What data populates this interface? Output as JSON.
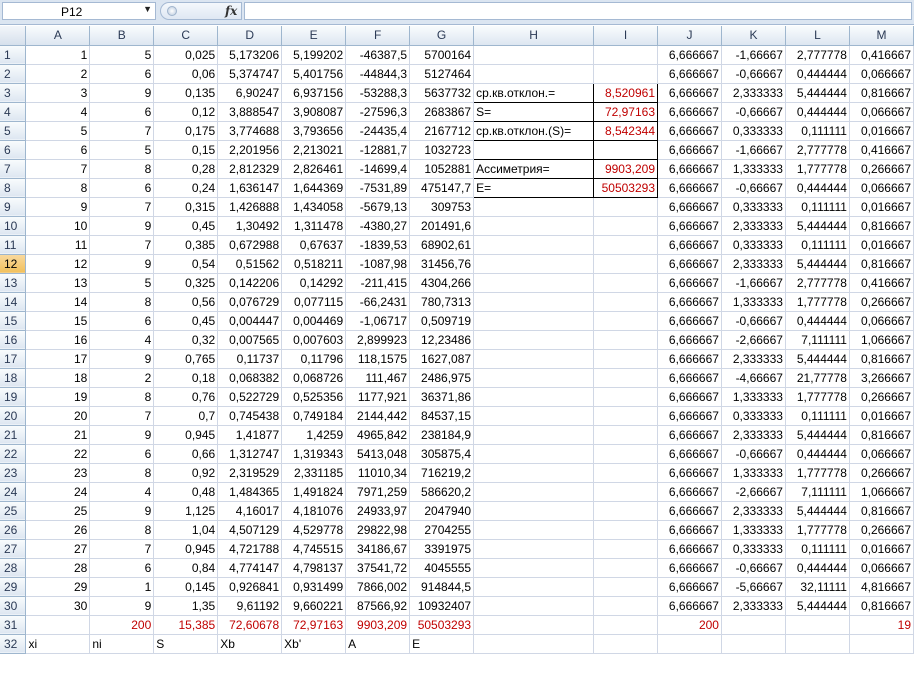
{
  "name_box": "P12",
  "fx_label": "fx",
  "columns": [
    "",
    "A",
    "B",
    "C",
    "D",
    "E",
    "F",
    "G",
    "H",
    "I",
    "J",
    "K",
    "L",
    "M"
  ],
  "selected_row": "12",
  "rows": [
    [
      "1",
      "1",
      "5",
      "0,025",
      "5,173206",
      "5,199202",
      "-46387,5",
      "5700164",
      "",
      "",
      "6,666667",
      "-1,66667",
      "2,777778",
      "0,416667"
    ],
    [
      "2",
      "2",
      "6",
      "0,06",
      "5,374747",
      "5,401756",
      "-44844,3",
      "5127464",
      "",
      "",
      "6,666667",
      "-0,66667",
      "0,444444",
      "0,066667"
    ],
    [
      "3",
      "3",
      "9",
      "0,135",
      "6,90247",
      "6,937156",
      "-53288,3",
      "5637732",
      "ср.кв.отклон.=",
      "8,520961",
      "6,666667",
      "2,333333",
      "5,444444",
      "0,816667"
    ],
    [
      "4",
      "4",
      "6",
      "0,12",
      "3,888547",
      "3,908087",
      "-27596,3",
      "2683867",
      "S=",
      "72,97163",
      "6,666667",
      "-0,66667",
      "0,444444",
      "0,066667"
    ],
    [
      "5",
      "5",
      "7",
      "0,175",
      "3,774688",
      "3,793656",
      "-24435,4",
      "2167712",
      "ср.кв.отклон.(S)=",
      "8,542344",
      "6,666667",
      "0,333333",
      "0,111111",
      "0,016667"
    ],
    [
      "6",
      "6",
      "5",
      "0,15",
      "2,201956",
      "2,213021",
      "-12881,7",
      "1032723",
      "",
      "",
      "6,666667",
      "-1,66667",
      "2,777778",
      "0,416667"
    ],
    [
      "7",
      "7",
      "8",
      "0,28",
      "2,812329",
      "2,826461",
      "-14699,4",
      "1052881",
      "Ассиметрия=",
      "9903,209",
      "6,666667",
      "1,333333",
      "1,777778",
      "0,266667"
    ],
    [
      "8",
      "8",
      "6",
      "0,24",
      "1,636147",
      "1,644369",
      "-7531,89",
      "475147,7",
      "E=",
      "50503293",
      "6,666667",
      "-0,66667",
      "0,444444",
      "0,066667"
    ],
    [
      "9",
      "9",
      "7",
      "0,315",
      "1,426888",
      "1,434058",
      "-5679,13",
      "309753",
      "",
      "",
      "6,666667",
      "0,333333",
      "0,111111",
      "0,016667"
    ],
    [
      "10",
      "10",
      "9",
      "0,45",
      "1,30492",
      "1,311478",
      "-4380,27",
      "201491,6",
      "",
      "",
      "6,666667",
      "2,333333",
      "5,444444",
      "0,816667"
    ],
    [
      "11",
      "11",
      "7",
      "0,385",
      "0,672988",
      "0,67637",
      "-1839,53",
      "68902,61",
      "",
      "",
      "6,666667",
      "0,333333",
      "0,111111",
      "0,016667"
    ],
    [
      "12",
      "12",
      "9",
      "0,54",
      "0,51562",
      "0,518211",
      "-1087,98",
      "31456,76",
      "",
      "",
      "6,666667",
      "2,333333",
      "5,444444",
      "0,816667"
    ],
    [
      "13",
      "13",
      "5",
      "0,325",
      "0,142206",
      "0,14292",
      "-211,415",
      "4304,266",
      "",
      "",
      "6,666667",
      "-1,66667",
      "2,777778",
      "0,416667"
    ],
    [
      "14",
      "14",
      "8",
      "0,56",
      "0,076729",
      "0,077115",
      "-66,2431",
      "780,7313",
      "",
      "",
      "6,666667",
      "1,333333",
      "1,777778",
      "0,266667"
    ],
    [
      "15",
      "15",
      "6",
      "0,45",
      "0,004447",
      "0,004469",
      "-1,06717",
      "0,509719",
      "",
      "",
      "6,666667",
      "-0,66667",
      "0,444444",
      "0,066667"
    ],
    [
      "16",
      "16",
      "4",
      "0,32",
      "0,007565",
      "0,007603",
      "2,899923",
      "12,23486",
      "",
      "",
      "6,666667",
      "-2,66667",
      "7,111111",
      "1,066667"
    ],
    [
      "17",
      "17",
      "9",
      "0,765",
      "0,11737",
      "0,11796",
      "118,1575",
      "1627,087",
      "",
      "",
      "6,666667",
      "2,333333",
      "5,444444",
      "0,816667"
    ],
    [
      "18",
      "18",
      "2",
      "0,18",
      "0,068382",
      "0,068726",
      "111,467",
      "2486,975",
      "",
      "",
      "6,666667",
      "-4,66667",
      "21,77778",
      "3,266667"
    ],
    [
      "19",
      "19",
      "8",
      "0,76",
      "0,522729",
      "0,525356",
      "1177,921",
      "36371,86",
      "",
      "",
      "6,666667",
      "1,333333",
      "1,777778",
      "0,266667"
    ],
    [
      "20",
      "20",
      "7",
      "0,7",
      "0,745438",
      "0,749184",
      "2144,442",
      "84537,15",
      "",
      "",
      "6,666667",
      "0,333333",
      "0,111111",
      "0,016667"
    ],
    [
      "21",
      "21",
      "9",
      "0,945",
      "1,41877",
      "1,4259",
      "4965,842",
      "238184,9",
      "",
      "",
      "6,666667",
      "2,333333",
      "5,444444",
      "0,816667"
    ],
    [
      "22",
      "22",
      "6",
      "0,66",
      "1,312747",
      "1,319343",
      "5413,048",
      "305875,4",
      "",
      "",
      "6,666667",
      "-0,66667",
      "0,444444",
      "0,066667"
    ],
    [
      "23",
      "23",
      "8",
      "0,92",
      "2,319529",
      "2,331185",
      "11010,34",
      "716219,2",
      "",
      "",
      "6,666667",
      "1,333333",
      "1,777778",
      "0,266667"
    ],
    [
      "24",
      "24",
      "4",
      "0,48",
      "1,484365",
      "1,491824",
      "7971,259",
      "586620,2",
      "",
      "",
      "6,666667",
      "-2,66667",
      "7,111111",
      "1,066667"
    ],
    [
      "25",
      "25",
      "9",
      "1,125",
      "4,16017",
      "4,181076",
      "24933,97",
      "2047940",
      "",
      "",
      "6,666667",
      "2,333333",
      "5,444444",
      "0,816667"
    ],
    [
      "26",
      "26",
      "8",
      "1,04",
      "4,507129",
      "4,529778",
      "29822,98",
      "2704255",
      "",
      "",
      "6,666667",
      "1,333333",
      "1,777778",
      "0,266667"
    ],
    [
      "27",
      "27",
      "7",
      "0,945",
      "4,721788",
      "4,745515",
      "34186,67",
      "3391975",
      "",
      "",
      "6,666667",
      "0,333333",
      "0,111111",
      "0,016667"
    ],
    [
      "28",
      "28",
      "6",
      "0,84",
      "4,774147",
      "4,798137",
      "37541,72",
      "4045555",
      "",
      "",
      "6,666667",
      "-0,66667",
      "0,444444",
      "0,066667"
    ],
    [
      "29",
      "29",
      "1",
      "0,145",
      "0,926841",
      "0,931499",
      "7866,002",
      "914844,5",
      "",
      "",
      "6,666667",
      "-5,66667",
      "32,11111",
      "4,816667"
    ],
    [
      "30",
      "30",
      "9",
      "1,35",
      "9,61192",
      "9,660221",
      "87566,92",
      "10932407",
      "",
      "",
      "6,666667",
      "2,333333",
      "5,444444",
      "0,816667"
    ],
    [
      "31",
      "",
      "200",
      "15,385",
      "72,60678",
      "72,97163",
      "9903,209",
      "50503293",
      "",
      "",
      "200",
      "",
      "",
      "19"
    ],
    [
      "32",
      "xi",
      "ni",
      "S",
      "Xb",
      "Xb'",
      "A",
      "E",
      "",
      "",
      "",
      "",
      "",
      ""
    ]
  ],
  "colors": {
    "red": "#c00000",
    "header_bg": "#dde6f1",
    "selected_header": "#f1c05c",
    "gridline": "#d0d7e5"
  }
}
